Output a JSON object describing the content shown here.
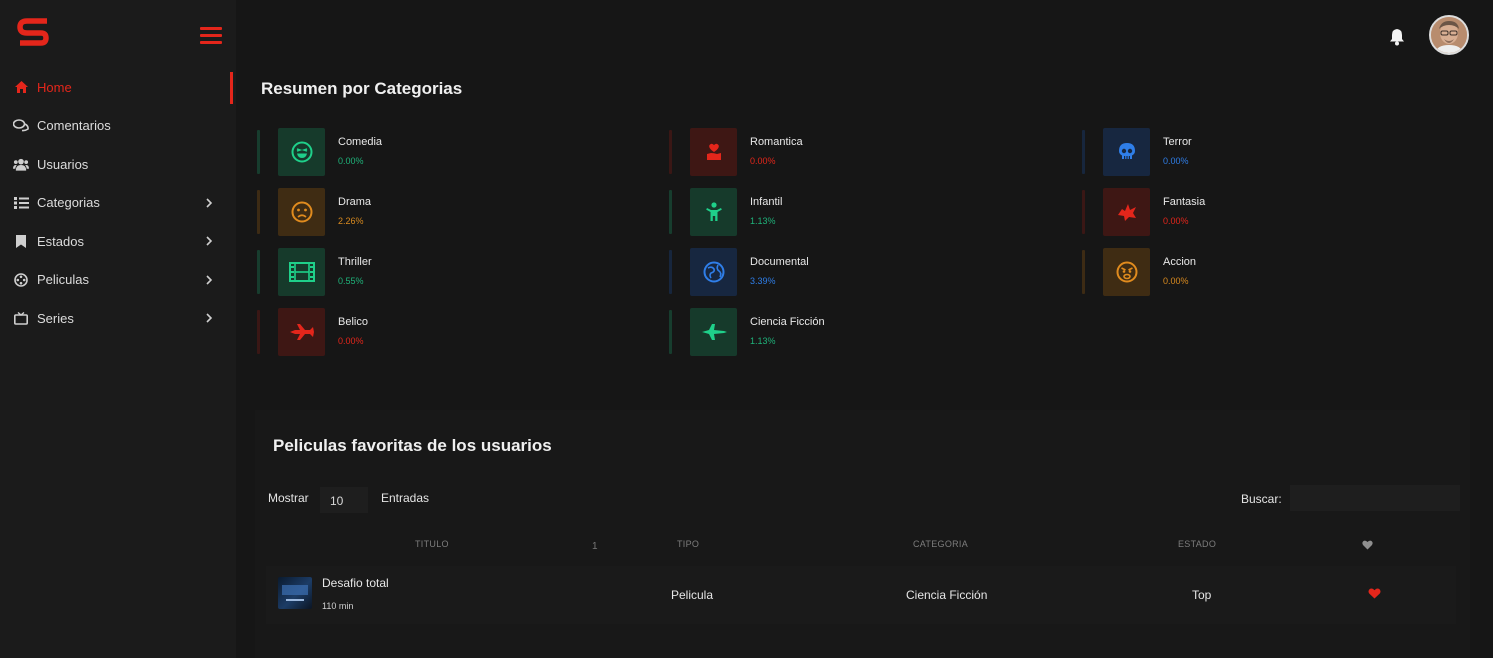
{
  "brand": {
    "accent": "#e4261b"
  },
  "sidebar": {
    "items": [
      {
        "label": "Home",
        "icon": "home-icon",
        "active": true
      },
      {
        "label": "Comentarios",
        "icon": "comments-icon"
      },
      {
        "label": "Usuarios",
        "icon": "users-icon"
      },
      {
        "label": "Categorias",
        "icon": "list-icon",
        "has_submenu": true
      },
      {
        "label": "Estados",
        "icon": "bookmark-icon",
        "has_submenu": true
      },
      {
        "label": "Peliculas",
        "icon": "film-reel-icon",
        "has_submenu": true
      },
      {
        "label": "Series",
        "icon": "tv-icon",
        "has_submenu": true
      }
    ]
  },
  "summary": {
    "title": "Resumen por Categorias",
    "categories": [
      {
        "name": "Comedia",
        "pct": "0.00%",
        "color": "#1fb37a",
        "icon": "laugh-face-icon"
      },
      {
        "name": "Romantica",
        "pct": "0.00%",
        "color": "#e4261b",
        "icon": "heart-hand-icon"
      },
      {
        "name": "Terror",
        "pct": "0.00%",
        "color": "#2f7ee8",
        "icon": "skull-icon"
      },
      {
        "name": "Drama",
        "pct": "2.26%",
        "color": "#d98a1f",
        "icon": "sad-face-icon"
      },
      {
        "name": "Infantil",
        "pct": "1.13%",
        "color": "#1fb37a",
        "icon": "child-icon"
      },
      {
        "name": "Fantasia",
        "pct": "0.00%",
        "color": "#e4261b",
        "icon": "dragon-icon"
      },
      {
        "name": "Thriller",
        "pct": "0.55%",
        "color": "#1fb37a",
        "icon": "film-strip-icon"
      },
      {
        "name": "Documental",
        "pct": "3.39%",
        "color": "#2f7ee8",
        "icon": "globe-icon"
      },
      {
        "name": "Accion",
        "pct": "0.00%",
        "color": "#d98a1f",
        "icon": "angry-face-icon"
      },
      {
        "name": "Belico",
        "pct": "0.00%",
        "color": "#e4261b",
        "icon": "fighter-jet-icon"
      },
      {
        "name": "Ciencia Ficción",
        "pct": "1.13%",
        "color": "#1fb37a",
        "icon": "spaceship-icon"
      }
    ]
  },
  "favorites": {
    "title": "Peliculas favoritas de los usuarios",
    "show_label": "Mostrar",
    "show_value": "10",
    "entries_label": "Entradas",
    "search_label": "Buscar:",
    "search_placeholder": "",
    "sort_indicator": "1",
    "columns": [
      "Titulo",
      "Tipo",
      "Categoria",
      "Estado"
    ],
    "rows": [
      {
        "title": "Desafio total",
        "duration": "110 min",
        "type": "Pelicula",
        "category": "Ciencia Ficción",
        "status": "Top",
        "favorite": true
      }
    ]
  }
}
